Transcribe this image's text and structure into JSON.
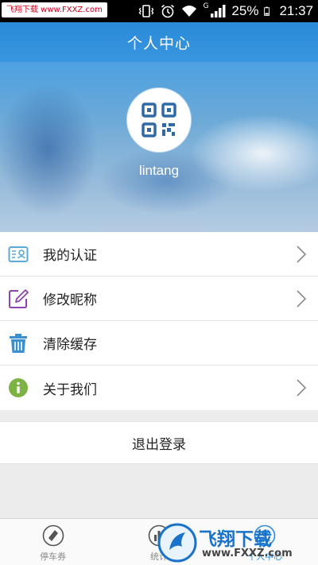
{
  "status_bar": {
    "watermark": "飞翔下载 www.FXXZ.com",
    "network": "G",
    "battery": "25%",
    "time": "21:37"
  },
  "header": {
    "title": "个人中心",
    "username": "lintang"
  },
  "menu": [
    {
      "label": "我的认证",
      "icon": "id-card-icon",
      "chevron": true
    },
    {
      "label": "修改昵称",
      "icon": "edit-icon",
      "chevron": true
    },
    {
      "label": "清除缓存",
      "icon": "trash-icon",
      "chevron": false
    },
    {
      "label": "关于我们",
      "icon": "info-icon",
      "chevron": true
    }
  ],
  "logout_label": "退出登录",
  "tabs": [
    {
      "label": "停车券",
      "icon": "ticket-icon",
      "active": false
    },
    {
      "label": "统计",
      "icon": "chart-icon",
      "active": false
    },
    {
      "label": "个人中心",
      "icon": "person-icon",
      "active": true
    }
  ],
  "watermark_logo": {
    "text": "飞翔下载",
    "url": "www.FXXZ.com"
  },
  "colors": {
    "accent": "#2d8be0",
    "header_blue": "#4fa1e0",
    "edit_icon": "#8e44ad",
    "trash_icon": "#3a8fd0",
    "info_icon": "#7cb342"
  }
}
